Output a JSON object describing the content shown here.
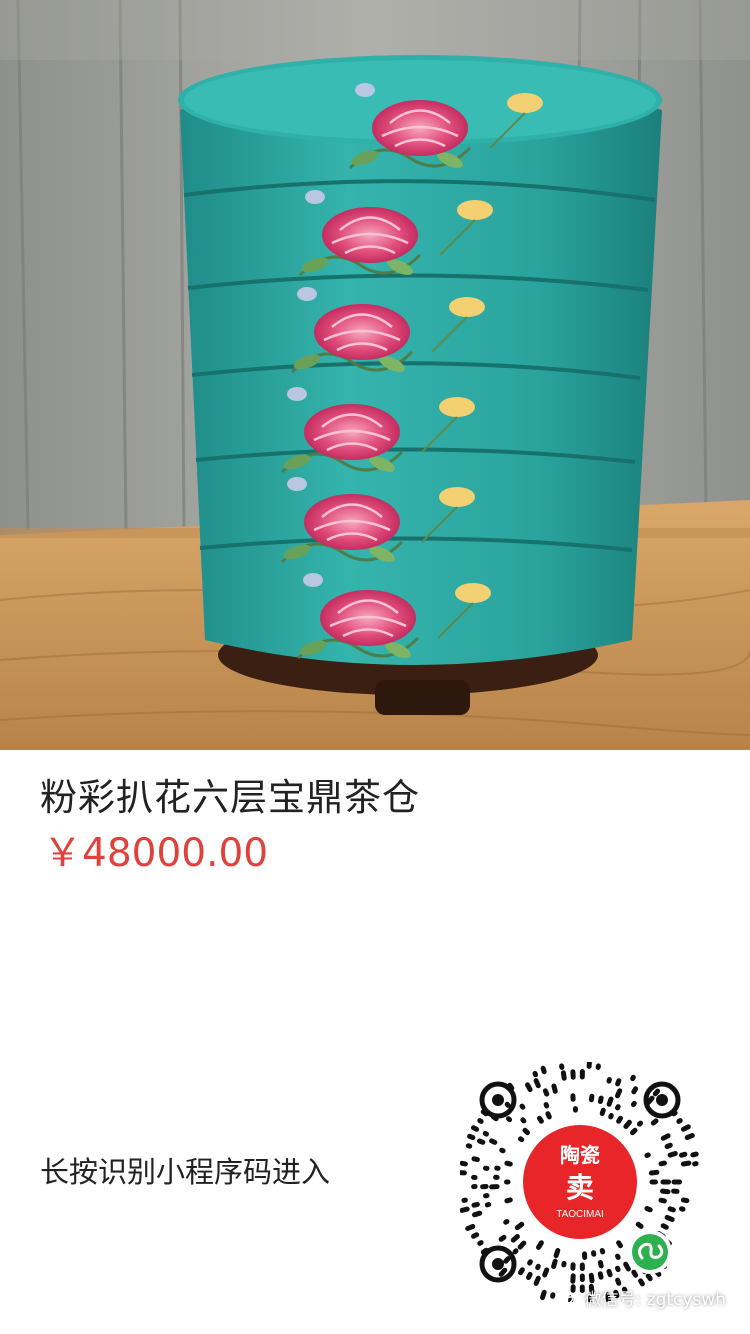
{
  "product": {
    "image_alt": "turquoise six-tier famille rose tea caddy on wooden table",
    "title": "粉彩扒花六层宝鼎茶仓",
    "price": "￥48000.00"
  },
  "footer": {
    "hint": "长按识别小程序码进入"
  },
  "qr": {
    "logo_top": "陶瓷",
    "logo_middle": "卖",
    "logo_bottom": "TAOCIMAI"
  },
  "watermark": {
    "text": "微信号: zgtcyswh",
    "icon": "wechat-icon"
  },
  "colors": {
    "price": "#e0413c",
    "turquoise": "#2aa5a0",
    "logo_red": "#e8262a",
    "miniprogram_green": "#2eb04f"
  }
}
